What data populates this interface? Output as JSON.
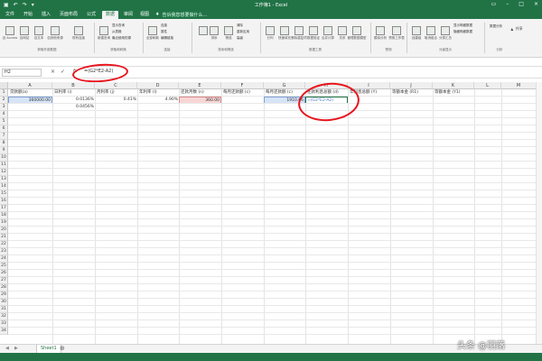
{
  "app": {
    "title": "工作簿1 - Excel",
    "quick_access": [
      "save-icon",
      "undo-icon",
      "redo-icon",
      "customize-icon"
    ]
  },
  "tabs": [
    "文件",
    "开始",
    "插入",
    "页面布局",
    "公式",
    "数据",
    "审阅",
    "视图"
  ],
  "active_tab": "数据",
  "tell_me": "告诉我您想要做什么...",
  "ribbon": {
    "groups": [
      "获取外部数据",
      "获取和转换",
      "连接",
      "排序和筛选",
      "数据工具",
      "预测",
      "分级显示",
      "分析"
    ],
    "buttons": [
      "自 Access",
      "自网站",
      "自文本",
      "自其他来源",
      "现有连接",
      "新建查询",
      "全部刷新",
      "排序",
      "筛选",
      "分列",
      "快速填充",
      "删除重复项",
      "数据验证",
      "合并计算",
      "关系",
      "管理数据模型",
      "模拟分析",
      "预测工作表",
      "创建组",
      "取消组合",
      "分类汇总",
      "数据分析"
    ],
    "small_buttons": [
      "显示查询",
      "从表格",
      "最近使用的源",
      "连接",
      "属性",
      "编辑链接",
      "清除",
      "重新应用",
      "高级",
      "显示明细数据",
      "隐藏明细数据"
    ],
    "share_label": "共享"
  },
  "formula_bar": {
    "name_box": "H2",
    "cancel": "×",
    "confirm": "✓",
    "fx": "fx",
    "content": "=(G2*E2-A2)"
  },
  "columns": [
    "A",
    "B",
    "C",
    "D",
    "E",
    "F",
    "G",
    "H",
    "I",
    "J",
    "K",
    "L",
    "M"
  ],
  "rows": [
    "1",
    "2",
    "3",
    "4",
    "5",
    "6",
    "7",
    "8",
    "9",
    "10",
    "11",
    "12",
    "13",
    "14",
    "15",
    "16",
    "17",
    "18",
    "19",
    "20",
    "21",
    "22",
    "23",
    "24",
    "25",
    "26",
    "27",
    "28",
    "29",
    "30",
    "31",
    "32",
    "33",
    "34"
  ],
  "row1": [
    "贷款额(a)",
    "日利率 (i)",
    "月利率 (j)",
    "年利率 (l)",
    "还款月数 (n)",
    "每月还款额 (c)",
    "每月还款额 (c)",
    "还款利息总额 (d)",
    "年利息总额 (Y)",
    "等额本金 (R1)",
    "等额本金 (Y1)"
  ],
  "cells": {
    "A2": "360000.00",
    "B2": "0.0136%",
    "B3": "0.0456%",
    "C2": "0.41%",
    "D2": "4.90%",
    "E2": "360.00",
    "G2": "1910.66",
    "H2": "=(G2*E2-A2)"
  },
  "sheet_tabs": [
    "Sheet1"
  ],
  "watermark": "头条 @羽落",
  "colors": {
    "excel_green": "#217346",
    "annotation_red": "#e8141d",
    "highlight_blue": "#d6e4f7",
    "highlight_red": "#f7d6d6"
  }
}
